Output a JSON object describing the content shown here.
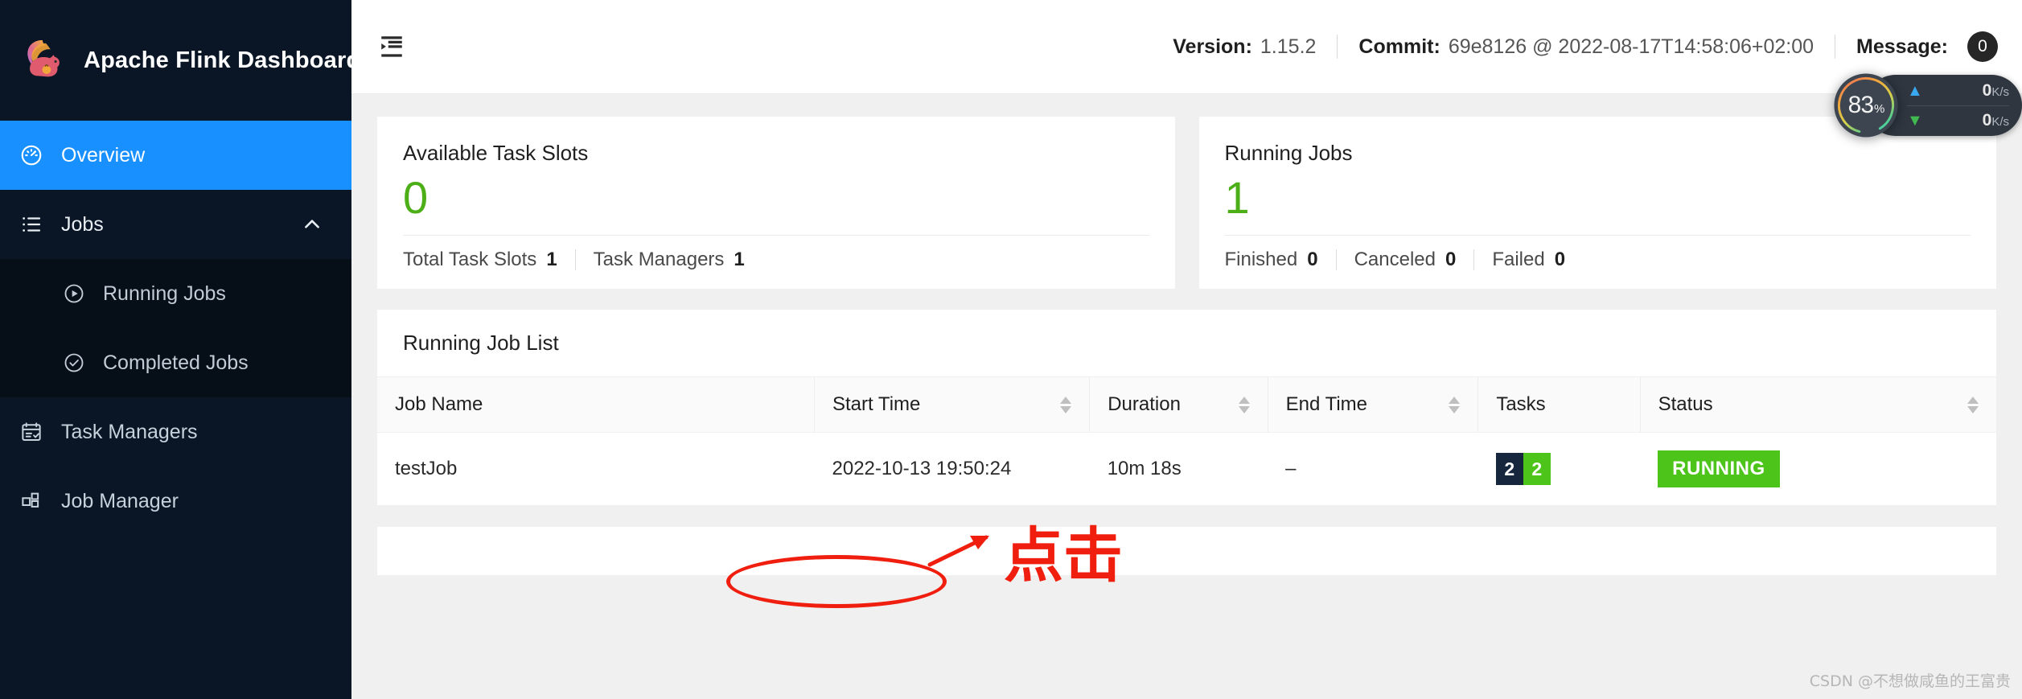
{
  "sidebar": {
    "brand": {
      "title": "Apache Flink Dashboard",
      "logo_icon": "flink-squirrel-logo"
    },
    "items": [
      {
        "label": "Overview",
        "icon": "dashboard-icon",
        "active": true
      },
      {
        "label": "Jobs",
        "icon": "list-icon",
        "expanded": true,
        "chevron": "chevron-up-icon"
      },
      {
        "label": "Task Managers",
        "icon": "task-manager-icon",
        "active": false
      },
      {
        "label": "Job Manager",
        "icon": "job-manager-icon",
        "active": false
      }
    ],
    "sub_items": [
      {
        "label": "Running Jobs",
        "icon": "play-circle-icon"
      },
      {
        "label": "Completed Jobs",
        "icon": "check-circle-icon"
      }
    ]
  },
  "topbar": {
    "fold_icon": "menu-fold-icon",
    "version_label": "Version:",
    "version_value": "1.15.2",
    "commit_label": "Commit:",
    "commit_value": "69e8126 @ 2022-08-17T14:58:06+02:00",
    "message_label": "Message:",
    "message_count": "0"
  },
  "cards": [
    {
      "title": "Available Task Slots",
      "value": "0",
      "value_color": "#4caf17",
      "footer": [
        {
          "label": "Total Task Slots",
          "value": "1"
        },
        {
          "label": "Task Managers",
          "value": "1"
        }
      ]
    },
    {
      "title": "Running Jobs",
      "value": "1",
      "value_color": "#4caf17",
      "footer": [
        {
          "label": "Finished",
          "value": "0"
        },
        {
          "label": "Canceled",
          "value": "0"
        },
        {
          "label": "Failed",
          "value": "0"
        }
      ]
    }
  ],
  "job_list": {
    "title": "Running Job List",
    "columns": [
      {
        "label": "Job Name",
        "sortable": false
      },
      {
        "label": "Start Time",
        "sortable": true
      },
      {
        "label": "Duration",
        "sortable": true
      },
      {
        "label": "End Time",
        "sortable": true
      },
      {
        "label": "Tasks",
        "sortable": false
      },
      {
        "label": "Status",
        "sortable": true
      }
    ],
    "rows": [
      {
        "job_name": "testJob",
        "start_time": "2022-10-13 19:50:24",
        "duration": "10m 18s",
        "end_time": "–",
        "tasks": [
          {
            "count": "2",
            "color": "#15263d"
          },
          {
            "count": "2",
            "color": "#4cc419"
          }
        ],
        "status": "RUNNING",
        "status_color": "#4cc419"
      }
    ]
  },
  "monitor": {
    "cpu_percent": "83",
    "percent_symbol": "%",
    "upload_value": "0",
    "upload_unit": "K/s",
    "upload_icon": "arrow-up-icon",
    "download_value": "0",
    "download_unit": "K/s",
    "download_icon": "arrow-down-icon"
  },
  "annotations": {
    "click_text": "点击",
    "color": "#f01e0f"
  },
  "watermark": "CSDN @不想做咸鱼的王富贵"
}
